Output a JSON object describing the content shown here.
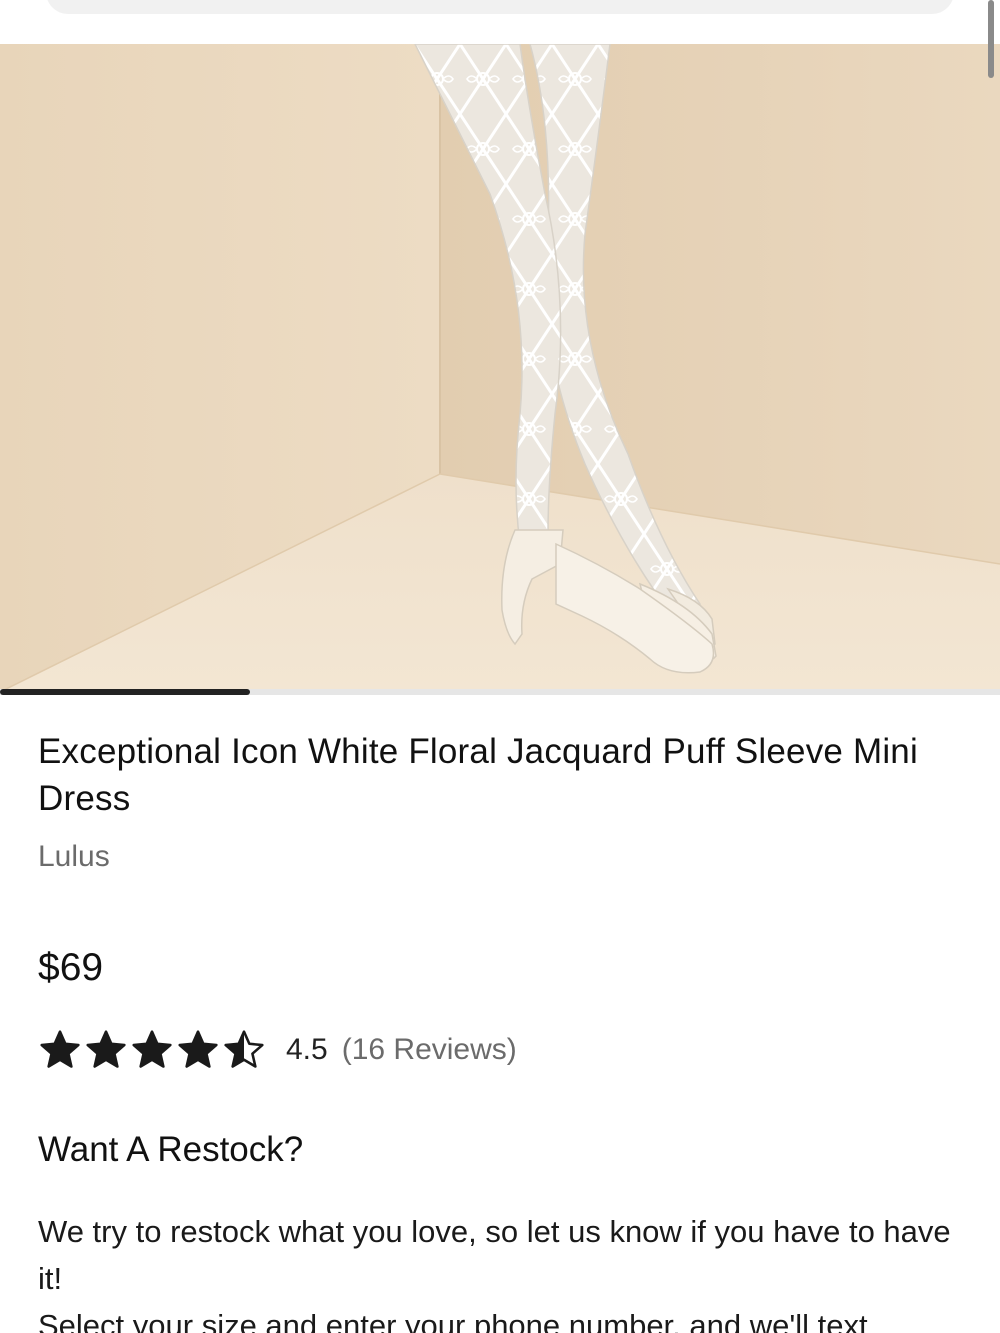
{
  "product": {
    "title": "Exceptional Icon White Floral Jacquard Puff Sleeve Mini Dress",
    "brand": "Lulus",
    "price": "$69",
    "image_carousel": {
      "progress_fraction": 0.25
    }
  },
  "rating": {
    "stars": 4.5,
    "value_label": "4.5",
    "reviews_label": "(16 Reviews)"
  },
  "restock": {
    "heading": "Want A Restock?",
    "paragraph1": "We try to restock what you love, so let us know if you have to have it!",
    "paragraph2": "Select your size and enter your phone number, and we'll text"
  },
  "colors": {
    "wall": "#ead8be",
    "star": "#1a1a1a",
    "carousel_active": "#222222"
  }
}
